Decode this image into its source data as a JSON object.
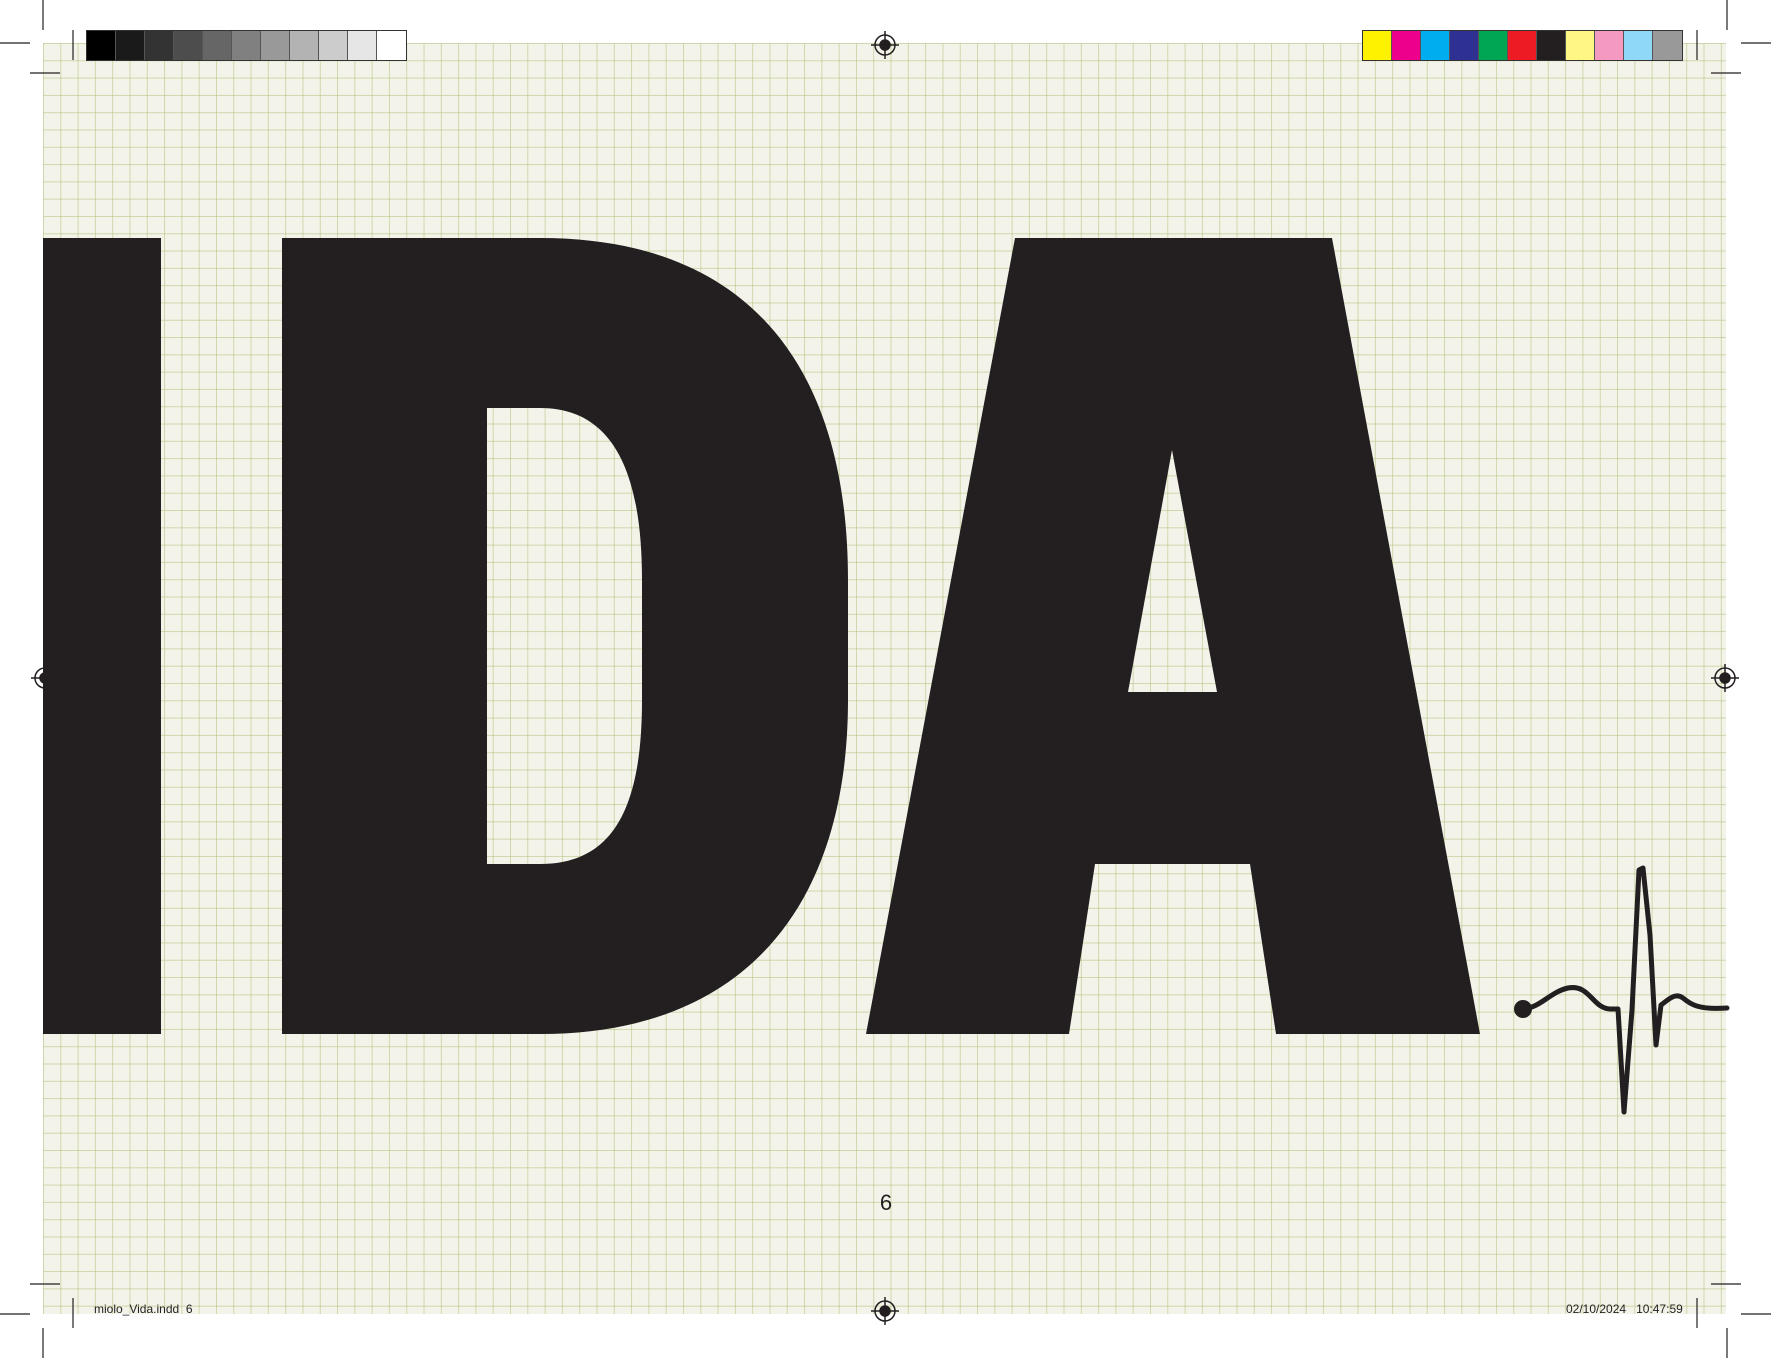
{
  "page": {
    "number": "6"
  },
  "artwork": {
    "word_fragment": "IDA",
    "ink_color": "#231f20",
    "paper_color": "#f4f3ea",
    "grid_color": "#b0c078"
  },
  "slug": {
    "file": "miolo_Vida.indd",
    "page": "6",
    "date": "02/10/2024",
    "time": "10:47:59"
  },
  "print_marks": {
    "grayscale_bar": [
      "#000000",
      "#1a1a1a",
      "#333333",
      "#4d4d4d",
      "#666666",
      "#808080",
      "#999999",
      "#b3b3b3",
      "#cccccc",
      "#e6e6e6",
      "#ffffff"
    ],
    "color_bar": [
      "#fff200",
      "#ec008c",
      "#00aeef",
      "#2e3192",
      "#00a651",
      "#ed1c24",
      "#231f20",
      "#fff684",
      "#f49ac1",
      "#8fd8f8",
      "#999999"
    ]
  }
}
